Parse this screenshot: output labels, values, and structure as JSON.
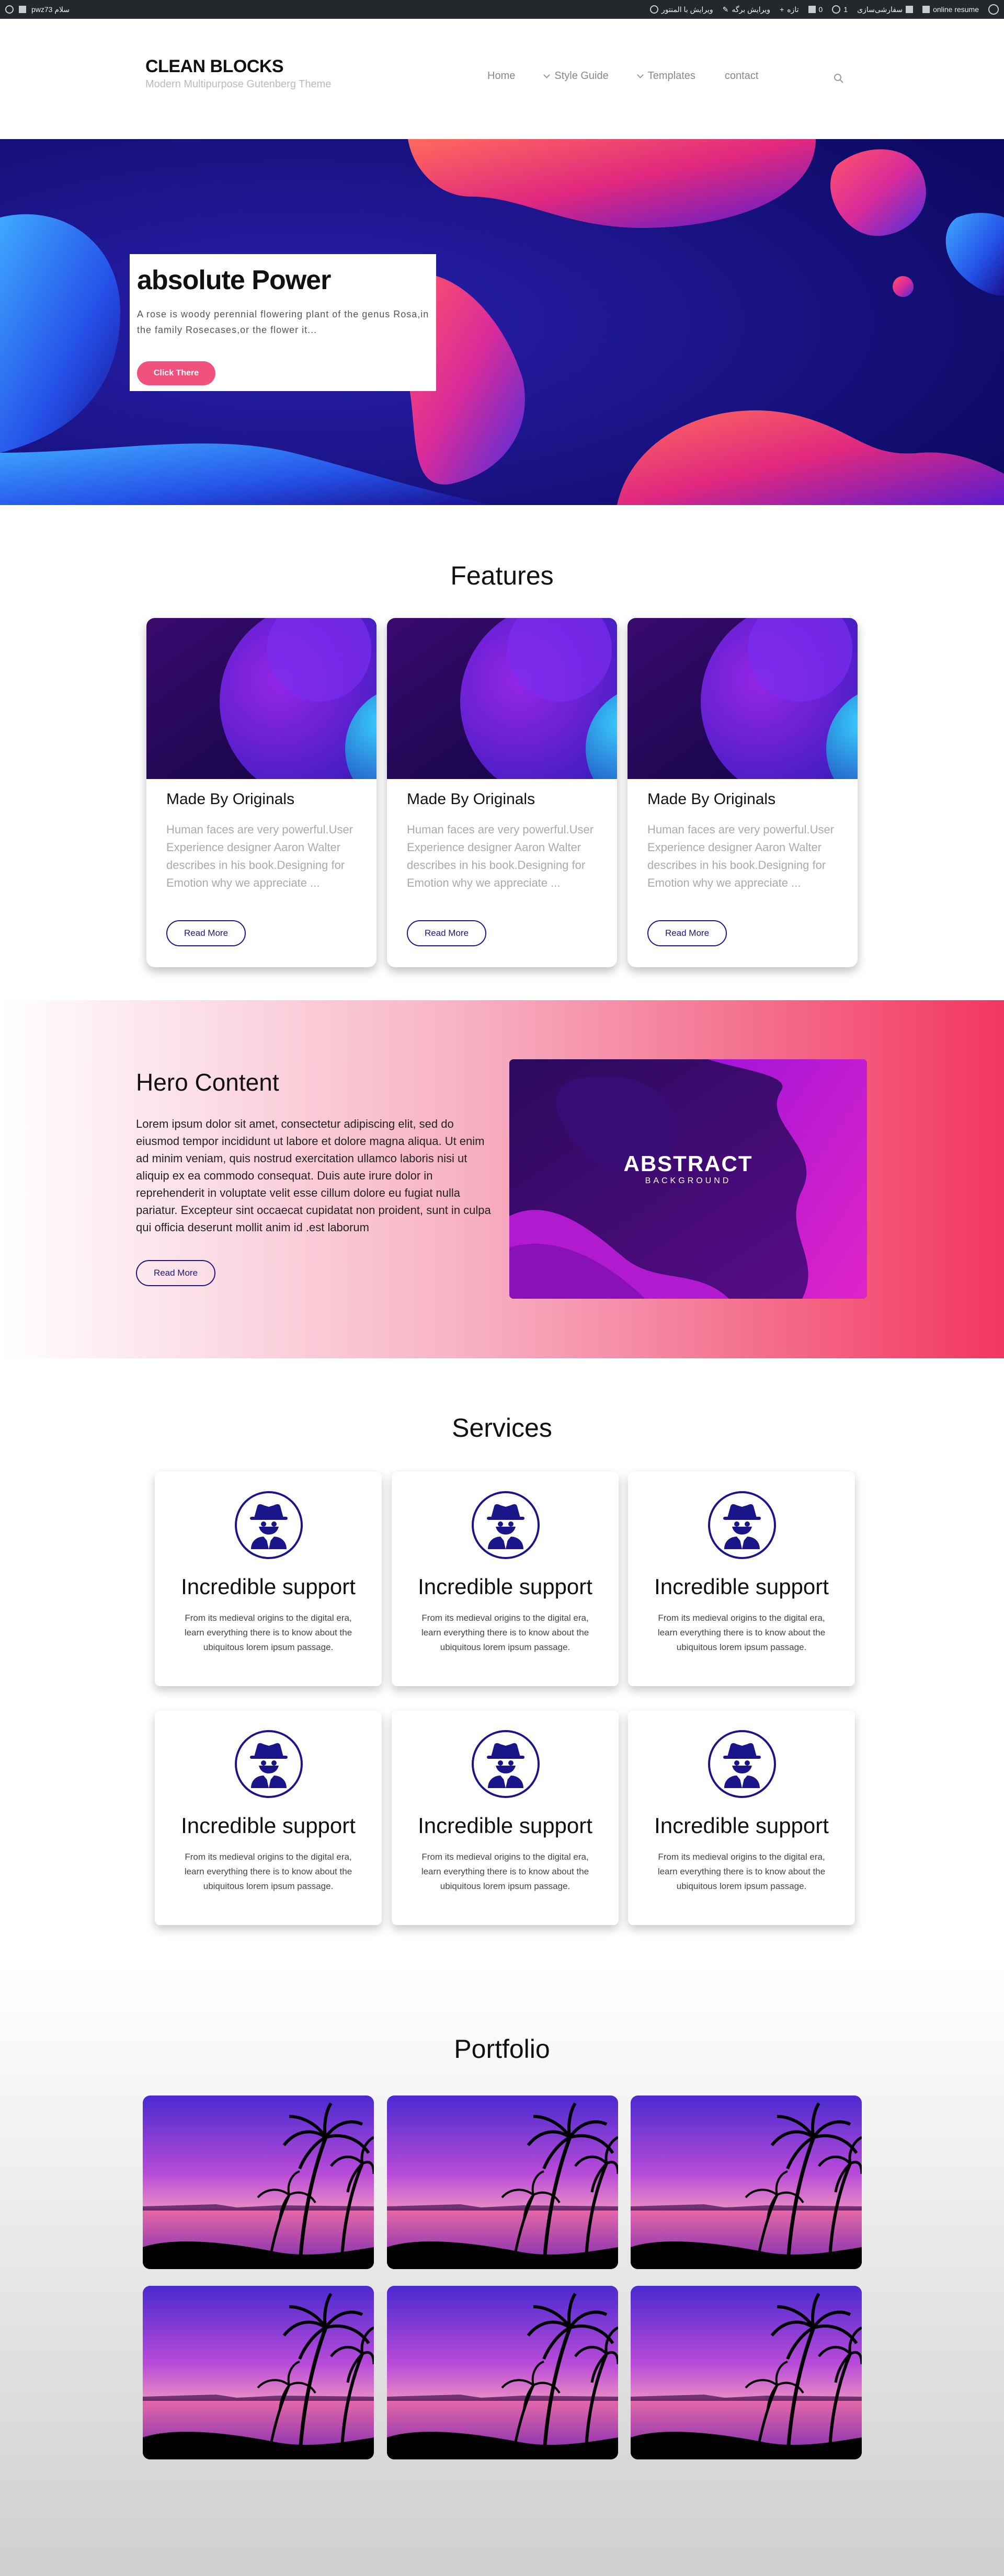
{
  "admin_bar": {
    "site_label": "pwz73 سلام",
    "edit_elementor": "ویرایش با المنتور",
    "edit_page": "ویرایش برگه",
    "new_label": "تازه",
    "comments_count": "0",
    "updates_count": "1",
    "customize": "سفارشی‌سازی",
    "site_name": "online resume"
  },
  "header": {
    "logo": "CLEAN BLOCKS",
    "tagline": "Modern Multipurpose Gutenberg Theme",
    "nav": [
      "Home",
      "Style Guide",
      "Templates",
      "contact"
    ]
  },
  "hero": {
    "title": "absolute Power",
    "text": "A rose is woody perennial flowering plant of the genus Rosa,in the family Rosecases,or the flower it...",
    "button": "Click There"
  },
  "features": {
    "title": "Features",
    "cards": [
      {
        "title": "Made By Originals",
        "text": "Human faces are very powerful.User Experience designer Aaron Walter describes in his book.Designing for Emotion why we appreciate ...",
        "button": "Read More"
      },
      {
        "title": "Made By Originals",
        "text": "Human faces are very powerful.User Experience designer Aaron Walter describes in his book.Designing for Emotion why we appreciate ...",
        "button": "Read More"
      },
      {
        "title": "Made By Originals",
        "text": "Human faces are very powerful.User Experience designer Aaron Walter describes in his book.Designing for Emotion why we appreciate ...",
        "button": "Read More"
      }
    ]
  },
  "hero_content": {
    "title": "Hero Content",
    "text": "Lorem ipsum dolor sit amet, consectetur adipiscing elit, sed do eiusmod tempor incididunt ut labore et dolore magna aliqua. Ut enim ad minim veniam, quis nostrud exercitation ullamco laboris nisi ut aliquip ex ea commodo consequat. Duis aute irure dolor in reprehenderit in voluptate velit esse cillum dolore eu fugiat nulla pariatur. Excepteur sint occaecat cupidatat non proident, sunt in culpa qui officia deserunt mollit anim id .est laborum",
    "button": "Read More",
    "image_title": "ABSTRACT",
    "image_subtitle": "BACKGROUND"
  },
  "services": {
    "title": "Services",
    "cards": [
      {
        "title": "Incredible support",
        "text": "From its medieval origins to the digital era, learn everything there is to know about the ubiquitous lorem ipsum passage."
      },
      {
        "title": "Incredible support",
        "text": "From its medieval origins to the digital era, learn everything there is to know about the ubiquitous lorem ipsum passage."
      },
      {
        "title": "Incredible support",
        "text": "From its medieval origins to the digital era, learn everything there is to know about the ubiquitous lorem ipsum passage."
      },
      {
        "title": "Incredible support",
        "text": "From its medieval origins to the digital era, learn everything there is to know about the ubiquitous lorem ipsum passage."
      },
      {
        "title": "Incredible support",
        "text": "From its medieval origins to the digital era, learn everything there is to know about the ubiquitous lorem ipsum passage."
      },
      {
        "title": "Incredible support",
        "text": "From its medieval origins to the digital era, learn everything there is to know about the ubiquitous lorem ipsum passage."
      }
    ]
  },
  "portfolio": {
    "title": "Portfolio"
  },
  "colors": {
    "accent": "#1a1588",
    "pink": "#f0517d",
    "hero_bg": "#140f7a",
    "admin_bar": "#23282d"
  }
}
